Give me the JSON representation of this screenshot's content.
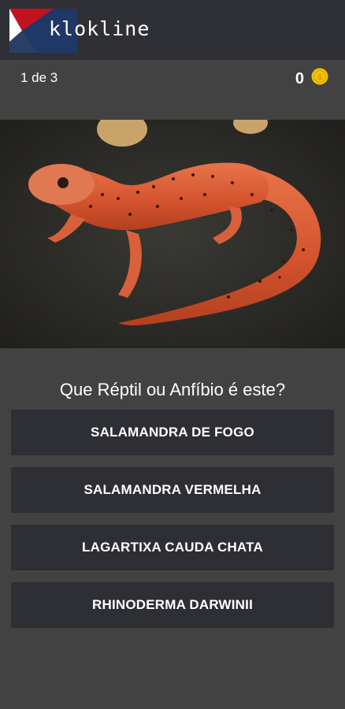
{
  "app": {
    "brand": "klokline",
    "logo_colors": [
      "#c1121f",
      "#1f3a6e",
      "#ffffff"
    ]
  },
  "status": {
    "progress": "1 de 3",
    "coins": "0",
    "coin_icon": "coin-icon",
    "coin_color": "#f2c200"
  },
  "image": {
    "subject_icon": "salamander-photo"
  },
  "quiz": {
    "question": "Que Réptil ou Anfíbio é este?",
    "answers": [
      "SALAMANDRA DE FOGO",
      "SALAMANDRA VERMELHA",
      "LAGARTIXA CAUDA CHATA",
      "RHINODERMA DARWINII"
    ]
  }
}
